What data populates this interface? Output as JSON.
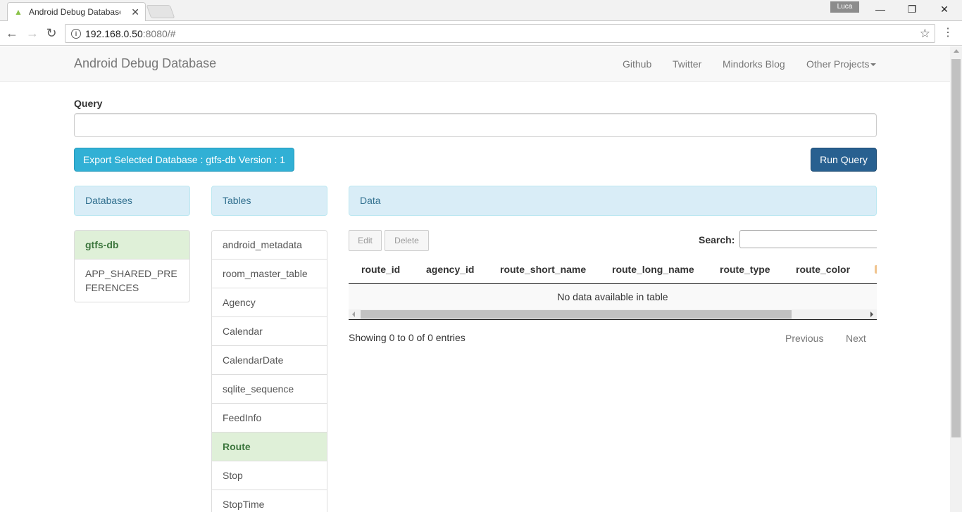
{
  "browser": {
    "tab_title": "Android Debug Database",
    "tab_close": "✕",
    "profile_name": "Luca",
    "url_host": "192.168.0.50",
    "url_rest": ":8080/#",
    "icons": {
      "favicon": "android-icon",
      "back": "back-arrow-icon",
      "forward": "forward-arrow-icon",
      "reload": "reload-icon",
      "info": "info-icon",
      "bookmark": "star-icon",
      "menu": "kebab-menu-icon"
    }
  },
  "navbar": {
    "brand": "Android Debug Database",
    "links": [
      "Github",
      "Twitter",
      "Mindorks Blog",
      "Other Projects"
    ]
  },
  "query": {
    "label": "Query",
    "value": "",
    "export_label": "Export Selected Database : gtfs-db Version : 1",
    "run_label": "Run Query"
  },
  "databases": {
    "heading": "Databases",
    "items": [
      "gtfs-db",
      "APP_SHARED_PREFERENCES"
    ],
    "active": "gtfs-db"
  },
  "tables": {
    "heading": "Tables",
    "items": [
      "android_metadata",
      "room_master_table",
      "Agency",
      "Calendar",
      "CalendarDate",
      "sqlite_sequence",
      "FeedInfo",
      "Route",
      "Stop",
      "StopTime"
    ],
    "active": "Route"
  },
  "data": {
    "heading": "Data",
    "edit_label": "Edit",
    "delete_label": "Delete",
    "search_label": "Search:",
    "search_value": "",
    "columns": [
      "route_id",
      "agency_id",
      "route_short_name",
      "route_long_name",
      "route_type",
      "route_color"
    ],
    "empty_message": "No data available in table",
    "info": "Showing 0 to 0 of 0 entries",
    "previous_label": "Previous",
    "next_label": "Next"
  },
  "colors": {
    "primary": "#286090",
    "info": "#31b0d5",
    "panel_heading_bg": "#d9edf7",
    "active_item_bg": "#dff0d8",
    "active_item_text": "#3c763d"
  }
}
